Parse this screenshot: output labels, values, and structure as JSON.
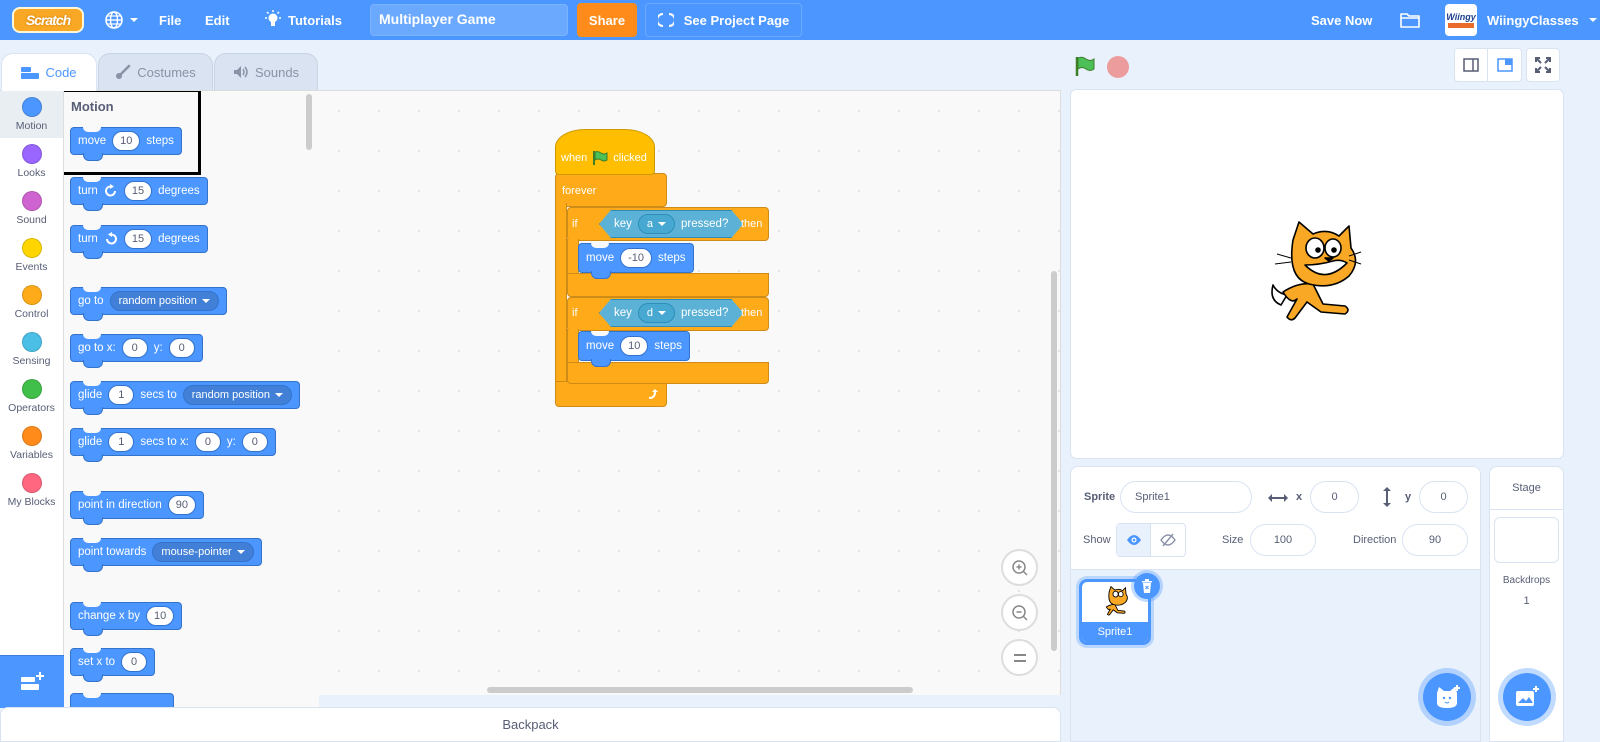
{
  "menubar": {
    "logo": "Scratch",
    "language_icon": "globe-icon",
    "file": "File",
    "edit": "Edit",
    "tutorials": "Tutorials",
    "project_title": "Multiplayer Game",
    "share": "Share",
    "see_project_page": "See Project Page",
    "save_now": "Save Now",
    "username": "WiingyClasses",
    "avatar_text": "Wiingy"
  },
  "tabs": [
    {
      "label": "Code",
      "active": true
    },
    {
      "label": "Costumes",
      "active": false
    },
    {
      "label": "Sounds",
      "active": false
    }
  ],
  "categories": [
    {
      "label": "Motion",
      "color": "#4c97ff"
    },
    {
      "label": "Looks",
      "color": "#9966ff"
    },
    {
      "label": "Sound",
      "color": "#cf63cf"
    },
    {
      "label": "Events",
      "color": "#ffd500"
    },
    {
      "label": "Control",
      "color": "#ffab19"
    },
    {
      "label": "Sensing",
      "color": "#4cbfe6"
    },
    {
      "label": "Operators",
      "color": "#40bf4a"
    },
    {
      "label": "Variables",
      "color": "#ff8c1a"
    },
    {
      "label": "My Blocks",
      "color": "#ff6680"
    }
  ],
  "palette": {
    "section_title": "Motion",
    "blocks": {
      "move": {
        "a": "move",
        "v": "10",
        "b": "steps"
      },
      "turn_cw": {
        "a": "turn",
        "v": "15",
        "b": "degrees"
      },
      "turn_ccw": {
        "a": "turn",
        "v": "15",
        "b": "degrees"
      },
      "goto": {
        "a": "go to",
        "menu": "random position"
      },
      "gotoxy": {
        "a": "go to x:",
        "x": "0",
        "b": "y:",
        "y": "0"
      },
      "glide_to": {
        "a": "glide",
        "v": "1",
        "b": "secs to",
        "menu": "random position"
      },
      "glide_xy": {
        "a": "glide",
        "v": "1",
        "b": "secs to x:",
        "x": "0",
        "c": "y:",
        "y": "0"
      },
      "point_dir": {
        "a": "point in direction",
        "v": "90"
      },
      "point_towards": {
        "a": "point towards",
        "menu": "mouse-pointer"
      },
      "change_x": {
        "a": "change x by",
        "v": "10"
      },
      "set_x": {
        "a": "set x to",
        "v": "0"
      }
    }
  },
  "script": {
    "hat": {
      "a": "when",
      "b": "clicked"
    },
    "forever": "forever",
    "if1": {
      "if": "if",
      "key": "key",
      "key_value": "a",
      "pressed": "pressed?",
      "then": "then",
      "move": "move",
      "steps_value": "-10",
      "steps": "steps"
    },
    "if2": {
      "if": "if",
      "key": "key",
      "key_value": "d",
      "pressed": "pressed?",
      "then": "then",
      "move": "move",
      "steps_value": "10",
      "steps": "steps"
    }
  },
  "sprite_info": {
    "sprite_label": "Sprite",
    "sprite_name": "Sprite1",
    "x_label": "x",
    "x": "0",
    "y_label": "y",
    "y": "0",
    "show_label": "Show",
    "size_label": "Size",
    "size": "100",
    "direction_label": "Direction",
    "direction": "90"
  },
  "sprites": [
    {
      "name": "Sprite1",
      "selected": true
    }
  ],
  "stage_pane": {
    "title": "Stage",
    "backdrops_label": "Backdrops",
    "backdrops_count": "1"
  },
  "backpack": "Backpack"
}
